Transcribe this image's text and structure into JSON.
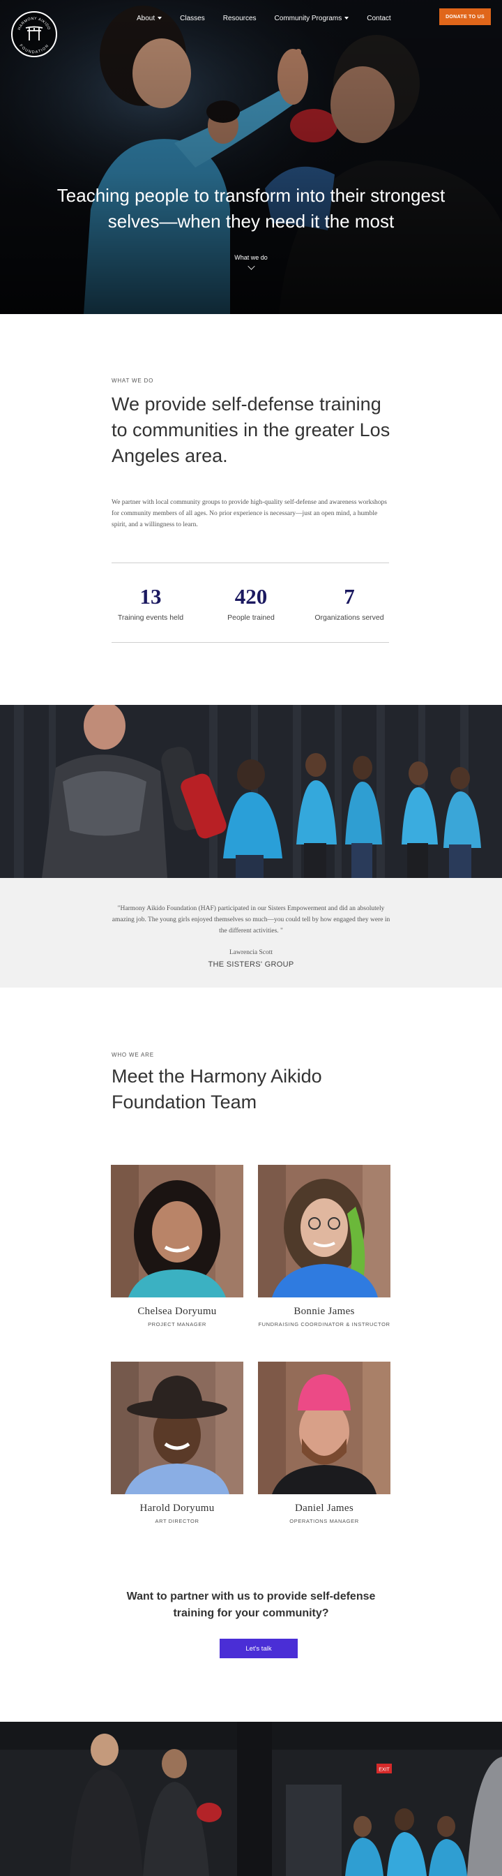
{
  "brand": {
    "logo_text_top": "HARMONY AIKIDO",
    "logo_text_bottom": "FOUNDATION",
    "accent": "#e0661a",
    "stat_color": "#1b1960",
    "button_color": "#4a2ed6"
  },
  "nav": {
    "items": [
      {
        "label": "About",
        "has_caret": true
      },
      {
        "label": "Classes",
        "has_caret": false
      },
      {
        "label": "Resources",
        "has_caret": false
      },
      {
        "label": "Community Programs",
        "has_caret": true
      },
      {
        "label": "Contact",
        "has_caret": false
      }
    ],
    "donate_label": "DONATE TO US"
  },
  "hero": {
    "title": "Teaching people to transform into their strongest selves—when they need it the most",
    "cta_label": "What we do"
  },
  "what_we_do": {
    "eyebrow": "WHAT WE DO",
    "heading": "We provide self-defense training to communities in the greater Los Angeles area.",
    "body": "We partner with local community groups to provide high-quality self-defense and awareness workshops for community members of all ages.  No prior experience is necessary—just an open mind, a humble spirit, and a willingness to learn.",
    "stats": [
      {
        "value": "13",
        "label": "Training events held"
      },
      {
        "value": "420",
        "label": "People trained"
      },
      {
        "value": "7",
        "label": "Organizations served"
      }
    ]
  },
  "testimonial": {
    "quote": "\"Harmony Aikido Foundation (HAF) participated in our Sisters Empowerment and did an absolutely amazing job. The young girls enjoyed themselves so much—you could tell by how engaged they were in the different activities. \"",
    "name": "Lawrencia Scott",
    "organization": "THE SISTERS' GROUP"
  },
  "team": {
    "eyebrow": "WHO WE ARE",
    "heading": "Meet the Harmony Aikido Foundation Team",
    "members": [
      {
        "name": "Chelsea Doryumu",
        "role": "PROJECT MANAGER"
      },
      {
        "name": "Bonnie James",
        "role": "FUNDRAISING COORDINATOR & INSTRUCTOR"
      },
      {
        "name": "Harold Doryumu",
        "role": "ART DIRECTOR"
      },
      {
        "name": "Daniel James",
        "role": "OPERATIONS MANAGER"
      }
    ]
  },
  "partner": {
    "heading": "Want to partner with us to provide self-defense training for your community?",
    "button_label": "Let's talk"
  },
  "footer_photo": {
    "sign_text": "EXIT"
  }
}
